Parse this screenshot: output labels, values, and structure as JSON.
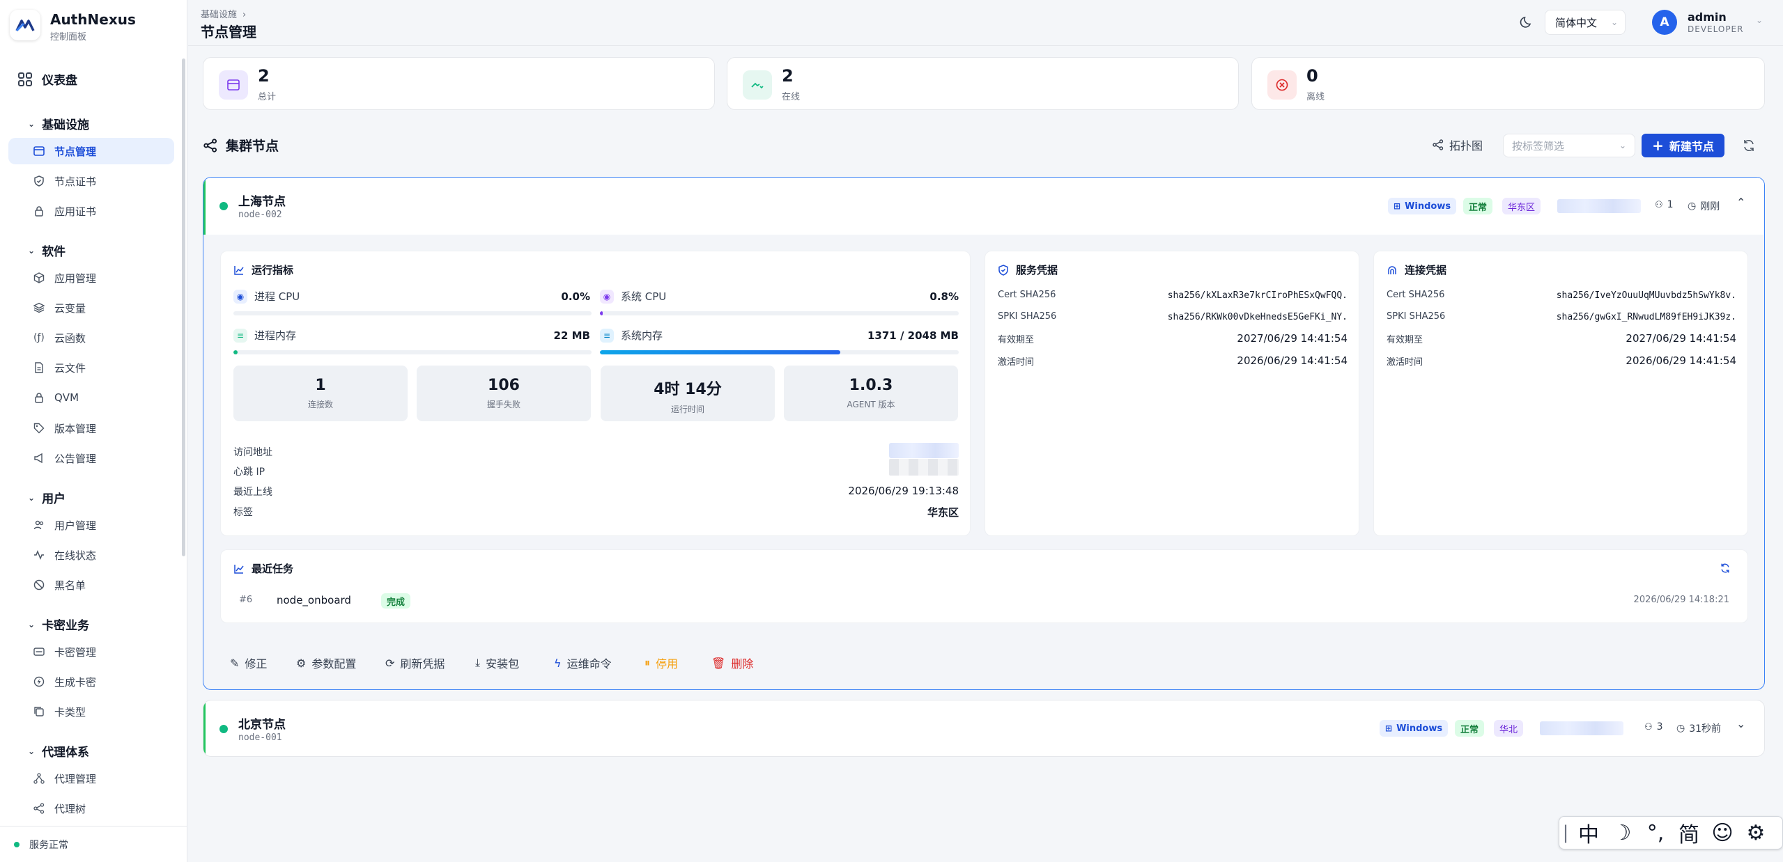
{
  "app": {
    "name": "AuthNexus",
    "subtitle": "控制面板"
  },
  "sidebar": {
    "dashboard": "仪表盘",
    "sections": [
      {
        "label": "基础设施",
        "items": [
          {
            "label": "节点管理",
            "icon": "server-icon",
            "active": true
          },
          {
            "label": "节点证书",
            "icon": "shield-icon"
          },
          {
            "label": "应用证书",
            "icon": "lock-icon"
          }
        ]
      },
      {
        "label": "软件",
        "items": [
          {
            "label": "应用管理",
            "icon": "cube-icon"
          },
          {
            "label": "云变量",
            "icon": "layers-icon"
          },
          {
            "label": "云函数",
            "icon": "function-icon"
          },
          {
            "label": "云文件",
            "icon": "file-icon"
          },
          {
            "label": "QVM",
            "icon": "lock-icon"
          },
          {
            "label": "版本管理",
            "icon": "tag-icon"
          },
          {
            "label": "公告管理",
            "icon": "megaphone-icon"
          }
        ]
      },
      {
        "label": "用户",
        "items": [
          {
            "label": "用户管理",
            "icon": "users-icon"
          },
          {
            "label": "在线状态",
            "icon": "pulse-icon"
          },
          {
            "label": "黑名单",
            "icon": "ban-icon"
          }
        ]
      },
      {
        "label": "卡密业务",
        "items": [
          {
            "label": "卡密管理",
            "icon": "card-icon"
          },
          {
            "label": "生成卡密",
            "icon": "bolt-icon"
          },
          {
            "label": "卡类型",
            "icon": "copy-icon"
          }
        ]
      },
      {
        "label": "代理体系",
        "items": [
          {
            "label": "代理管理",
            "icon": "hierarchy-icon"
          },
          {
            "label": "代理树",
            "icon": "share-icon"
          }
        ]
      }
    ],
    "footer_status": "服务正常"
  },
  "header": {
    "breadcrumb": "基础设施",
    "title": "节点管理",
    "language": "简体中文",
    "user": {
      "initial": "A",
      "name": "admin",
      "role": "DEVELOPER"
    }
  },
  "stats": [
    {
      "value": "2",
      "label": "总计"
    },
    {
      "value": "2",
      "label": "在线"
    },
    {
      "value": "0",
      "label": "离线"
    }
  ],
  "section": {
    "title": "集群节点",
    "topology": "拓扑图",
    "filter_placeholder": "按标签筛选",
    "new_node": "新建节点"
  },
  "nodes": [
    {
      "name": "上海节点",
      "id": "node-002",
      "os": "Windows",
      "status": "正常",
      "zone": "华东区",
      "connections": "1",
      "last_seen": "刚刚",
      "metrics": {
        "title": "运行指标",
        "proc_cpu": {
          "label": "进程 CPU",
          "value": "0.0%",
          "percent": 0
        },
        "sys_cpu": {
          "label": "系统 CPU",
          "value": "0.8%",
          "percent": 0.8
        },
        "proc_mem": {
          "label": "进程内存",
          "value": "22 MB",
          "percent": 1.1
        },
        "sys_mem": {
          "label": "系统内存",
          "value": "1371 / 2048 MB",
          "percent": 67
        },
        "tiles": [
          {
            "value": "1",
            "label": "连接数"
          },
          {
            "value": "106",
            "label": "握手失败"
          },
          {
            "value": "4时 14分",
            "label": "运行时间"
          },
          {
            "value": "1.0.3",
            "label": "AGENT 版本"
          }
        ],
        "info": [
          {
            "key": "访问地址",
            "value": ""
          },
          {
            "key": "心跳 IP",
            "value": ""
          },
          {
            "key": "最近上线",
            "value": "2026/06/29 19:13:48"
          },
          {
            "key": "标签",
            "value": "华东区"
          }
        ]
      },
      "service_cred": {
        "title": "服务凭据",
        "rows": [
          {
            "key": "Cert SHA256",
            "value": "sha256/kXLaxR3e7krCIroPhESxQwFQQ."
          },
          {
            "key": "SPKI SHA256",
            "value": "sha256/RKWk00vDkeHnedsE5GeFKi_NY."
          },
          {
            "key": "有效期至",
            "value": "2027/06/29 14:41:54"
          },
          {
            "key": "激活时间",
            "value": "2026/06/29 14:41:54"
          }
        ]
      },
      "conn_cred": {
        "title": "连接凭据",
        "rows": [
          {
            "key": "Cert SHA256",
            "value": "sha256/IveYzOuuUqMUuvbdz5hSwYk8v."
          },
          {
            "key": "SPKI SHA256",
            "value": "sha256/gwGxI_RNwudLM89fEH9iJK39z."
          },
          {
            "key": "有效期至",
            "value": "2027/06/29 14:41:54"
          },
          {
            "key": "激活时间",
            "value": "2026/06/29 14:41:54"
          }
        ]
      },
      "tasks": {
        "title": "最近任务",
        "items": [
          {
            "id": "#6",
            "name": "node_onboard",
            "status": "完成",
            "time": "2026/06/29 14:18:21"
          }
        ]
      },
      "actions": [
        "修正",
        "参数配置",
        "刷新凭据",
        "安装包",
        "运维命令",
        "停用",
        "删除"
      ]
    },
    {
      "name": "北京节点",
      "id": "node-001",
      "os": "Windows",
      "status": "正常",
      "zone": "华北",
      "connections": "3",
      "last_seen": "31秒前"
    }
  ],
  "ime": {
    "keys": [
      "中",
      "☽",
      "°,",
      "简",
      "☺",
      "⚙"
    ]
  },
  "colors": {
    "primary": "#1d4ed8",
    "success": "#10b981",
    "danger": "#dc2626",
    "warning": "#f59e0b"
  }
}
